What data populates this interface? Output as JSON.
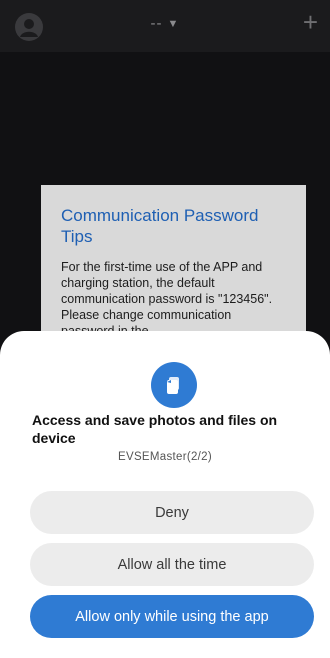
{
  "header": {
    "device_name": "--",
    "dropdown_icon": "caret-down-icon",
    "add_icon": "plus-icon",
    "avatar_icon": "user-avatar-icon"
  },
  "tips_dialog": {
    "title": "Communication Password Tips",
    "body": "For the first-time use of the APP and charging station, the default communication password is \"123456\". Please change communication password in the"
  },
  "permission_sheet": {
    "icon": "files-icon",
    "title": "Access and save photos and files on device",
    "subtitle": "EVSEMaster(2/2)",
    "deny_label": "Deny",
    "allow_always_label": "Allow all the time",
    "allow_while_using_label": "Allow only while using the app"
  },
  "colors": {
    "accent": "#2f7bd3",
    "dialog_title": "#1e5fb3",
    "background": "#1b1b1d"
  }
}
